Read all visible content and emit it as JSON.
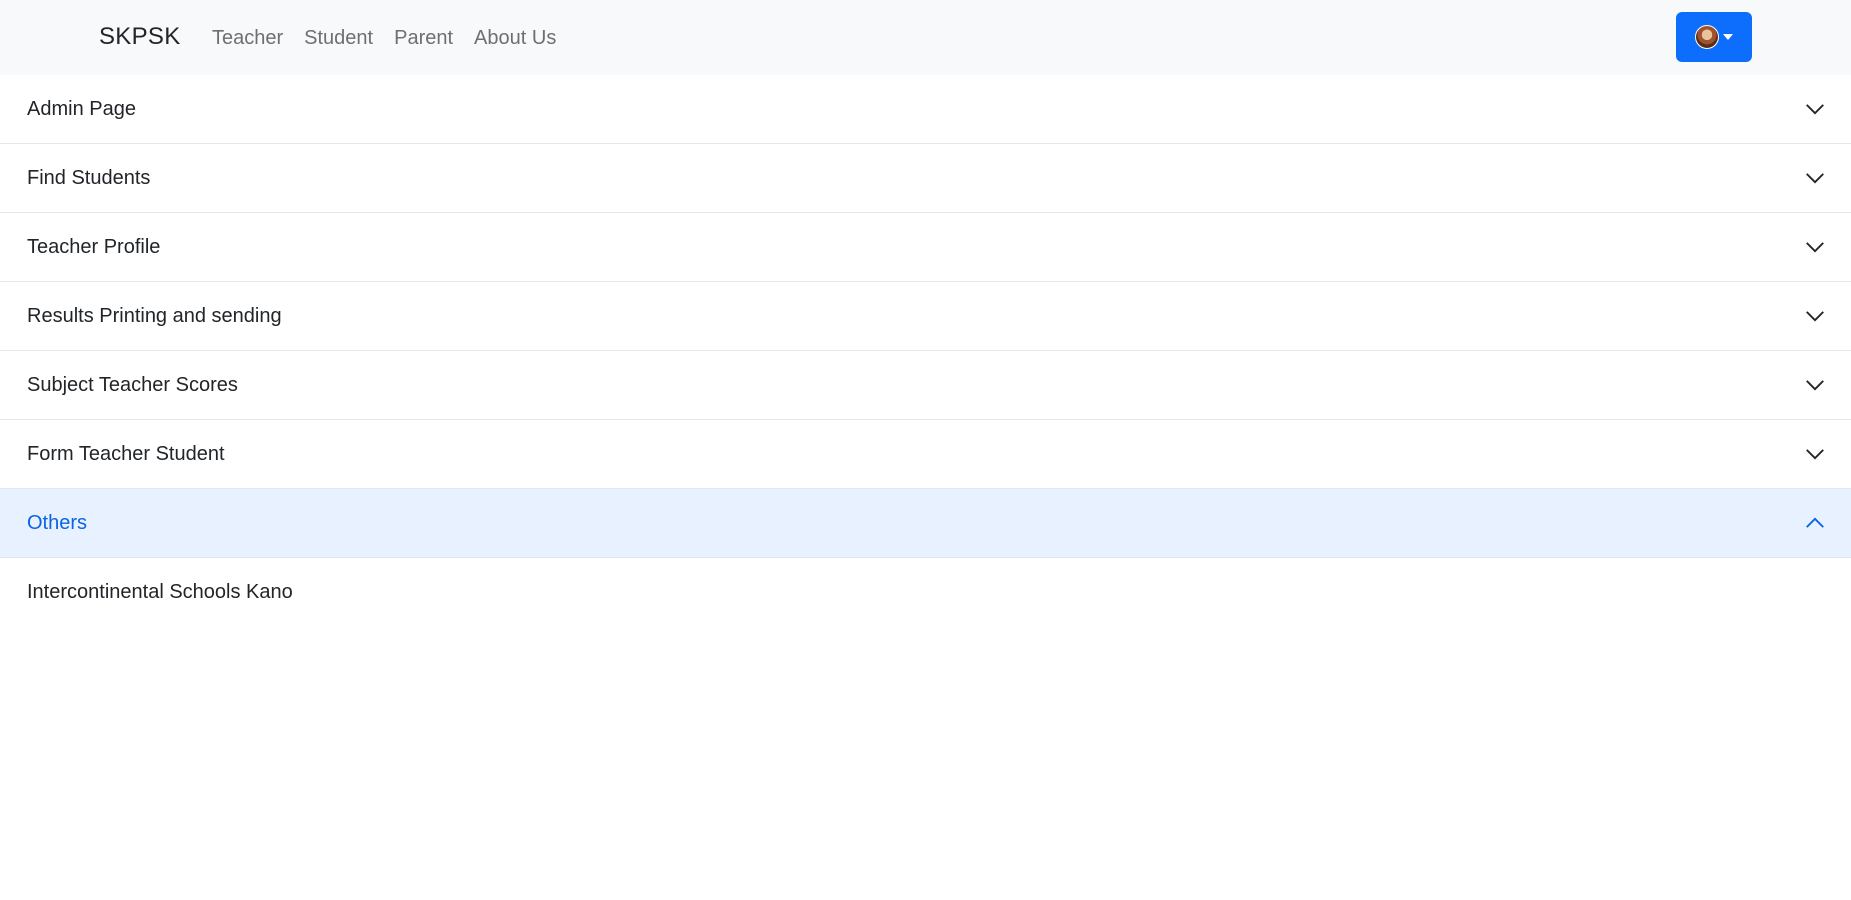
{
  "navbar": {
    "brand": "SKPSK",
    "links": [
      "Teacher",
      "Student",
      "Parent",
      "About Us"
    ],
    "user_button": {
      "avatar_icon": "user-avatar",
      "caret_icon": "caret-down-icon",
      "color": "#0d6efd"
    }
  },
  "accordion": {
    "items": [
      {
        "label": "Admin Page",
        "expanded": false
      },
      {
        "label": "Find Students",
        "expanded": false
      },
      {
        "label": "Teacher Profile",
        "expanded": false
      },
      {
        "label": "Results Printing and sending",
        "expanded": false
      },
      {
        "label": "Subject Teacher Scores",
        "expanded": false
      },
      {
        "label": "Form Teacher Student",
        "expanded": false
      },
      {
        "label": "Others",
        "expanded": true
      }
    ],
    "expanded_body": "Intercontinental Schools Kano",
    "active_color": "#0c63e4",
    "active_bg": "#e7f1ff"
  }
}
